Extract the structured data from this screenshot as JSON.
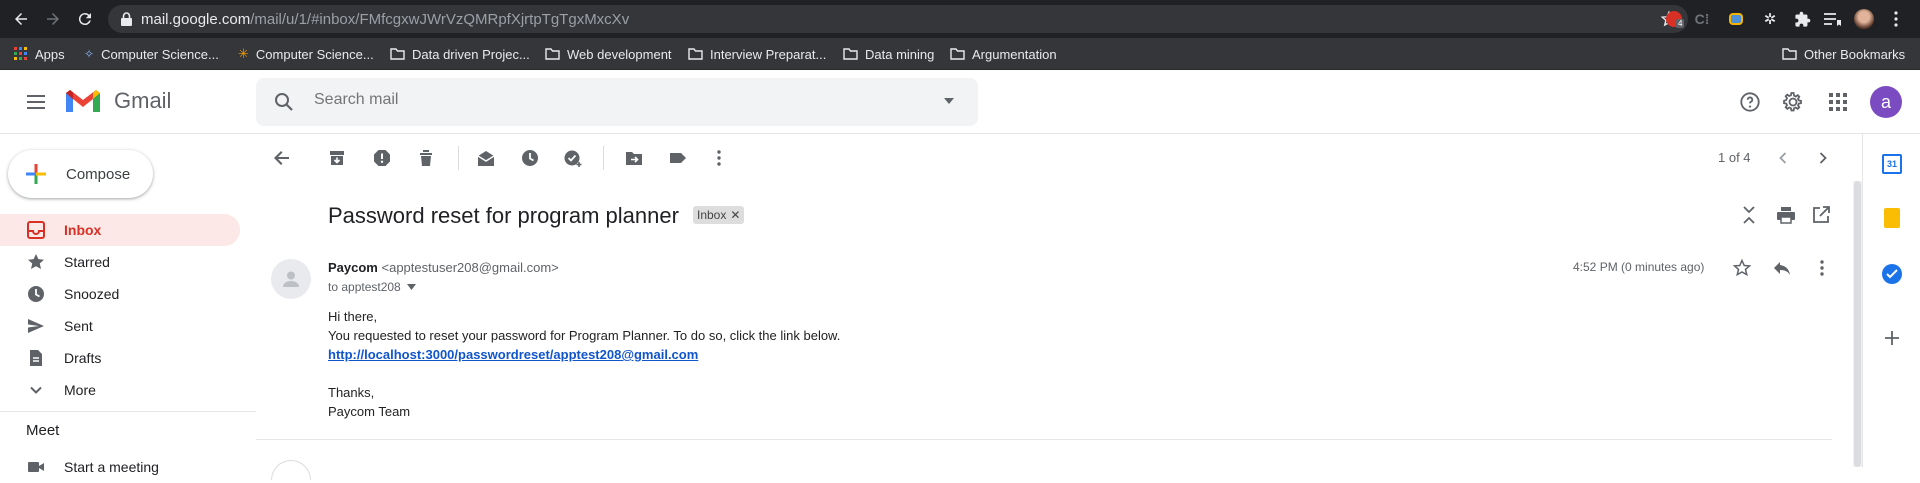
{
  "browser": {
    "url_host": "mail.google.com",
    "url_path": "/mail/u/1/#inbox/FMfcgxwJWrVzQMRpfXjrtpTgTgxMxcXv",
    "ext_badge": "4"
  },
  "bookmarks": [
    {
      "label": "Apps"
    },
    {
      "label": "Computer Science..."
    },
    {
      "label": "Computer Science..."
    },
    {
      "label": "Data driven Projec..."
    },
    {
      "label": "Web development"
    },
    {
      "label": "Interview Preparat..."
    },
    {
      "label": "Data mining"
    },
    {
      "label": "Argumentation"
    },
    {
      "label": "Other Bookmarks"
    }
  ],
  "gmail": {
    "logo_text": "Gmail",
    "search_placeholder": "Search mail",
    "avatar_letter": "a"
  },
  "sidebar": {
    "compose_label": "Compose",
    "items": [
      {
        "label": "Inbox",
        "active": true
      },
      {
        "label": "Starred"
      },
      {
        "label": "Snoozed"
      },
      {
        "label": "Sent"
      },
      {
        "label": "Drafts"
      },
      {
        "label": "More"
      }
    ],
    "meet_title": "Meet",
    "meet_items": [
      {
        "label": "Start a meeting"
      }
    ]
  },
  "toolbar": {
    "pager_text": "1 of 4"
  },
  "message": {
    "subject": "Password reset for program planner",
    "label_chip": "Inbox",
    "sender_name": "Paycom",
    "sender_email": "<apptestuser208@gmail.com>",
    "to_text": "to apptest208",
    "time_text": "4:52 PM (0 minutes ago)",
    "body_lines": [
      "Hi there,",
      "You requested to reset your password for Program Planner. To do so, click the link below."
    ],
    "link_text": "http://localhost:3000/passwordreset/apptest208@gmail.com",
    "closing_lines": [
      "Thanks,",
      "Paycom Team"
    ]
  },
  "colors": {
    "active_nav_bg": "#fce8e6",
    "active_nav_fg": "#d93025",
    "link": "#1155cc",
    "avatar": "#7b4bc2"
  }
}
